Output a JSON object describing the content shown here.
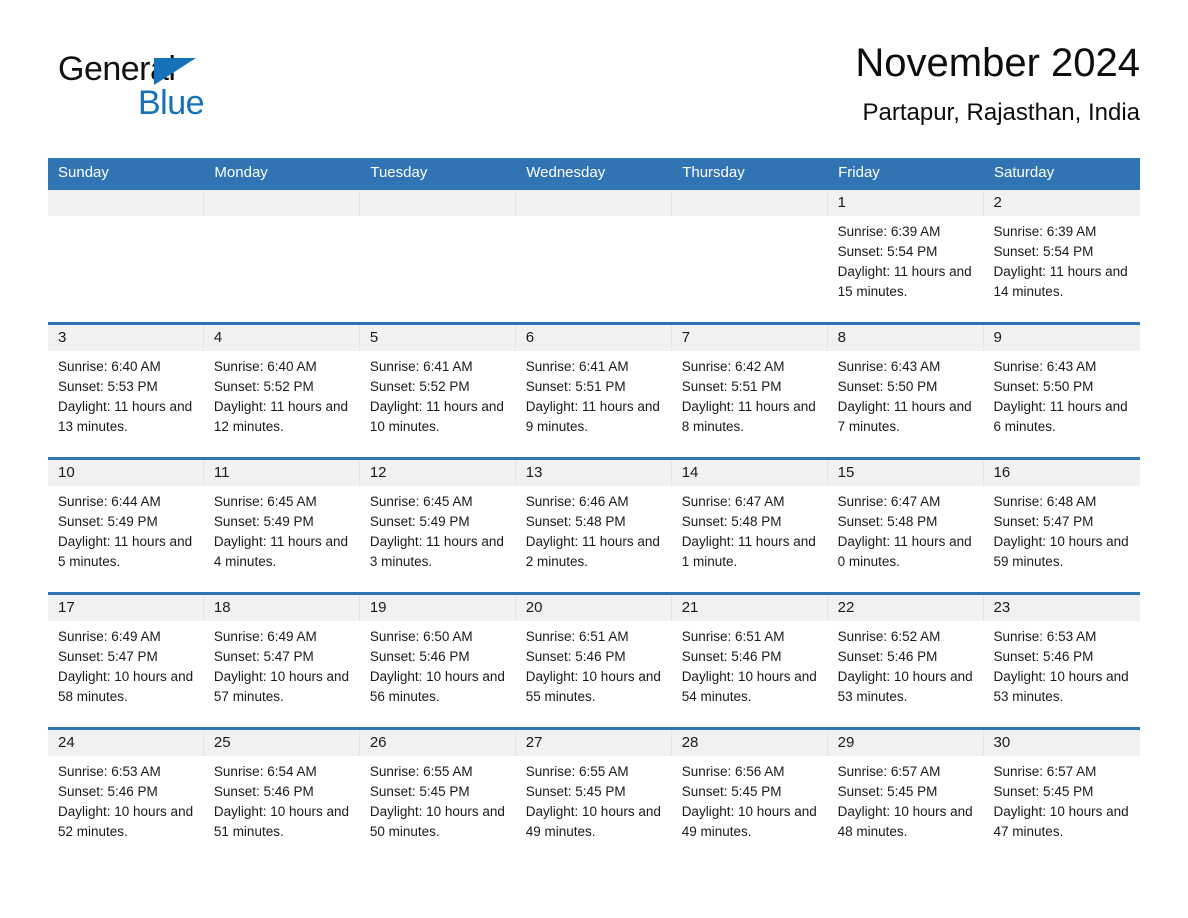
{
  "logo": {
    "word_one": "General",
    "word_two": "Blue",
    "triangle_icon": "triangle-icon",
    "brand_color": "#1572b8"
  },
  "header": {
    "title": "November 2024",
    "location": "Partapur, Rajasthan, India"
  },
  "theme": {
    "header_blue": "#3174b3",
    "day_band_gray": "#f1f1f1",
    "text_color": "#1a1a1a"
  },
  "calendar": {
    "weekday_headers": [
      "Sunday",
      "Monday",
      "Tuesday",
      "Wednesday",
      "Thursday",
      "Friday",
      "Saturday"
    ],
    "weeks": [
      [
        {
          "day": "",
          "sunrise": "",
          "sunset": "",
          "daylight": ""
        },
        {
          "day": "",
          "sunrise": "",
          "sunset": "",
          "daylight": ""
        },
        {
          "day": "",
          "sunrise": "",
          "sunset": "",
          "daylight": ""
        },
        {
          "day": "",
          "sunrise": "",
          "sunset": "",
          "daylight": ""
        },
        {
          "day": "",
          "sunrise": "",
          "sunset": "",
          "daylight": ""
        },
        {
          "day": "1",
          "sunrise": "Sunrise: 6:39 AM",
          "sunset": "Sunset: 5:54 PM",
          "daylight": "Daylight: 11 hours and 15 minutes."
        },
        {
          "day": "2",
          "sunrise": "Sunrise: 6:39 AM",
          "sunset": "Sunset: 5:54 PM",
          "daylight": "Daylight: 11 hours and 14 minutes."
        }
      ],
      [
        {
          "day": "3",
          "sunrise": "Sunrise: 6:40 AM",
          "sunset": "Sunset: 5:53 PM",
          "daylight": "Daylight: 11 hours and 13 minutes."
        },
        {
          "day": "4",
          "sunrise": "Sunrise: 6:40 AM",
          "sunset": "Sunset: 5:52 PM",
          "daylight": "Daylight: 11 hours and 12 minutes."
        },
        {
          "day": "5",
          "sunrise": "Sunrise: 6:41 AM",
          "sunset": "Sunset: 5:52 PM",
          "daylight": "Daylight: 11 hours and 10 minutes."
        },
        {
          "day": "6",
          "sunrise": "Sunrise: 6:41 AM",
          "sunset": "Sunset: 5:51 PM",
          "daylight": "Daylight: 11 hours and 9 minutes."
        },
        {
          "day": "7",
          "sunrise": "Sunrise: 6:42 AM",
          "sunset": "Sunset: 5:51 PM",
          "daylight": "Daylight: 11 hours and 8 minutes."
        },
        {
          "day": "8",
          "sunrise": "Sunrise: 6:43 AM",
          "sunset": "Sunset: 5:50 PM",
          "daylight": "Daylight: 11 hours and 7 minutes."
        },
        {
          "day": "9",
          "sunrise": "Sunrise: 6:43 AM",
          "sunset": "Sunset: 5:50 PM",
          "daylight": "Daylight: 11 hours and 6 minutes."
        }
      ],
      [
        {
          "day": "10",
          "sunrise": "Sunrise: 6:44 AM",
          "sunset": "Sunset: 5:49 PM",
          "daylight": "Daylight: 11 hours and 5 minutes."
        },
        {
          "day": "11",
          "sunrise": "Sunrise: 6:45 AM",
          "sunset": "Sunset: 5:49 PM",
          "daylight": "Daylight: 11 hours and 4 minutes."
        },
        {
          "day": "12",
          "sunrise": "Sunrise: 6:45 AM",
          "sunset": "Sunset: 5:49 PM",
          "daylight": "Daylight: 11 hours and 3 minutes."
        },
        {
          "day": "13",
          "sunrise": "Sunrise: 6:46 AM",
          "sunset": "Sunset: 5:48 PM",
          "daylight": "Daylight: 11 hours and 2 minutes."
        },
        {
          "day": "14",
          "sunrise": "Sunrise: 6:47 AM",
          "sunset": "Sunset: 5:48 PM",
          "daylight": "Daylight: 11 hours and 1 minute."
        },
        {
          "day": "15",
          "sunrise": "Sunrise: 6:47 AM",
          "sunset": "Sunset: 5:48 PM",
          "daylight": "Daylight: 11 hours and 0 minutes."
        },
        {
          "day": "16",
          "sunrise": "Sunrise: 6:48 AM",
          "sunset": "Sunset: 5:47 PM",
          "daylight": "Daylight: 10 hours and 59 minutes."
        }
      ],
      [
        {
          "day": "17",
          "sunrise": "Sunrise: 6:49 AM",
          "sunset": "Sunset: 5:47 PM",
          "daylight": "Daylight: 10 hours and 58 minutes."
        },
        {
          "day": "18",
          "sunrise": "Sunrise: 6:49 AM",
          "sunset": "Sunset: 5:47 PM",
          "daylight": "Daylight: 10 hours and 57 minutes."
        },
        {
          "day": "19",
          "sunrise": "Sunrise: 6:50 AM",
          "sunset": "Sunset: 5:46 PM",
          "daylight": "Daylight: 10 hours and 56 minutes."
        },
        {
          "day": "20",
          "sunrise": "Sunrise: 6:51 AM",
          "sunset": "Sunset: 5:46 PM",
          "daylight": "Daylight: 10 hours and 55 minutes."
        },
        {
          "day": "21",
          "sunrise": "Sunrise: 6:51 AM",
          "sunset": "Sunset: 5:46 PM",
          "daylight": "Daylight: 10 hours and 54 minutes."
        },
        {
          "day": "22",
          "sunrise": "Sunrise: 6:52 AM",
          "sunset": "Sunset: 5:46 PM",
          "daylight": "Daylight: 10 hours and 53 minutes."
        },
        {
          "day": "23",
          "sunrise": "Sunrise: 6:53 AM",
          "sunset": "Sunset: 5:46 PM",
          "daylight": "Daylight: 10 hours and 53 minutes."
        }
      ],
      [
        {
          "day": "24",
          "sunrise": "Sunrise: 6:53 AM",
          "sunset": "Sunset: 5:46 PM",
          "daylight": "Daylight: 10 hours and 52 minutes."
        },
        {
          "day": "25",
          "sunrise": "Sunrise: 6:54 AM",
          "sunset": "Sunset: 5:46 PM",
          "daylight": "Daylight: 10 hours and 51 minutes."
        },
        {
          "day": "26",
          "sunrise": "Sunrise: 6:55 AM",
          "sunset": "Sunset: 5:45 PM",
          "daylight": "Daylight: 10 hours and 50 minutes."
        },
        {
          "day": "27",
          "sunrise": "Sunrise: 6:55 AM",
          "sunset": "Sunset: 5:45 PM",
          "daylight": "Daylight: 10 hours and 49 minutes."
        },
        {
          "day": "28",
          "sunrise": "Sunrise: 6:56 AM",
          "sunset": "Sunset: 5:45 PM",
          "daylight": "Daylight: 10 hours and 49 minutes."
        },
        {
          "day": "29",
          "sunrise": "Sunrise: 6:57 AM",
          "sunset": "Sunset: 5:45 PM",
          "daylight": "Daylight: 10 hours and 48 minutes."
        },
        {
          "day": "30",
          "sunrise": "Sunrise: 6:57 AM",
          "sunset": "Sunset: 5:45 PM",
          "daylight": "Daylight: 10 hours and 47 minutes."
        }
      ]
    ]
  }
}
